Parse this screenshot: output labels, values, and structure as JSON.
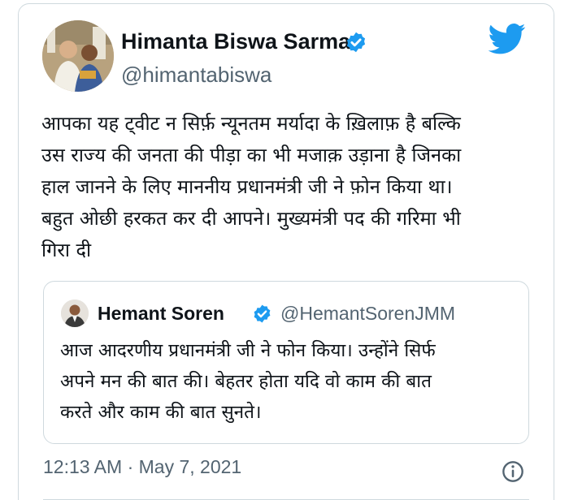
{
  "tweet": {
    "author_name": "Himanta Biswa Sarma",
    "author_handle": "@himantabiswa",
    "text_lines": [
      "आपका यह ट्वीट न सिर्फ़ न्यूनतम मर्यादा के ख़िलाफ़ है बल्कि",
      "उस राज्य की जनता की पीड़ा का भी मजाक़ उड़ाना है जिनका",
      "हाल जानने के लिए माननीय प्रधानमंत्री जी ने फ़ोन किया था।",
      "बहुत ओछी हरकत कर दी आपने। मुख्यमंत्री पद की गरिमा भी",
      "गिरा दी"
    ],
    "timestamp": "12:13 AM · May 7, 2021"
  },
  "quoted_tweet": {
    "author_name": "Hemant Soren",
    "author_handle": "@HemantSorenJMM",
    "text_lines": [
      "आज आदरणीय प्रधानमंत्री जी ने फोन किया। उन्होंने सिर्फ",
      "अपने मन की बात की। बेहतर होता यदि वो काम की बात",
      "करते और काम की बात सुनते।"
    ]
  },
  "icons": {
    "verified": "verified-badge-icon",
    "brand": "twitter-bird-icon",
    "info": "info-icon"
  },
  "colors": {
    "twitter_blue": "#1d9bf0",
    "text_primary": "#0f1419",
    "text_secondary": "#536471",
    "border": "#cfd9de"
  }
}
